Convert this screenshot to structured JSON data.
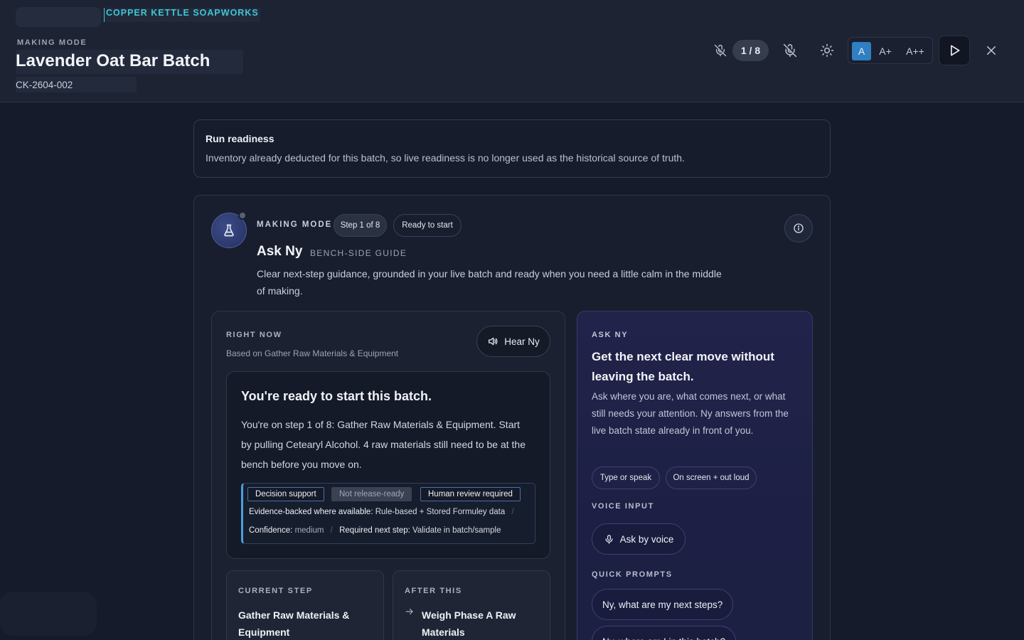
{
  "header": {
    "brand": "COPPER KETTLE SOAPWORKS",
    "mode_kicker": "MAKING MODE",
    "title": "Lavender Oat Bar Batch",
    "batch_code": "CK-2604-002",
    "step_counter": "1 / 8",
    "text_sizes": [
      "A",
      "A+",
      "A++"
    ],
    "icons": [
      "mute-icon",
      "mic-off-icon",
      "sun-icon",
      "play-icon",
      "close-icon"
    ]
  },
  "readiness": {
    "title": "Run readiness",
    "text": "Inventory already deducted for this batch, so live readiness is no longer used as the historical source of truth."
  },
  "guide": {
    "kicker": "MAKING MODE",
    "step_chip": "Step 1 of 8",
    "ready_chip": "Ready to start",
    "title": "Ask Ny",
    "subtitle": "BENCH-SIDE GUIDE",
    "description": "Clear next-step guidance, grounded in your live batch and ready when you need a little calm in the middle of making."
  },
  "right_now": {
    "kicker": "RIGHT NOW",
    "basis": "Based on Gather Raw Materials & Equipment",
    "hear_label": "Hear Ny",
    "ready_title": "You're ready to start this batch.",
    "ready_body": "You're on step 1 of 8: Gather Raw Materials & Equipment. Start by pulling Cetearyl Alcohol. 4 raw materials still need to be at the bench before you move on.",
    "tags": [
      "Decision support",
      "Not release-ready",
      "Human review required"
    ],
    "evidence_label": "Evidence-backed where available:",
    "evidence_value": "Rule-based + Stored Formuley data",
    "confidence_label": "Confidence:",
    "confidence_value": "medium",
    "next_step_label": "Required next step:",
    "next_step_value": "Validate in batch/sample",
    "current_step_kicker": "CURRENT STEP",
    "current_step": "Gather Raw Materials & Equipment",
    "after_kicker": "AFTER THIS",
    "after_step": "Weigh Phase A Raw Materials"
  },
  "ask_panel": {
    "kicker": "ASK NY",
    "title": "Get the next clear move without leaving the batch.",
    "description": "Ask where you are, what comes next, or what still needs your attention. Ny answers from the live batch state already in front of you.",
    "chips": [
      "Type or speak",
      "On screen + out loud"
    ],
    "voice_section": "VOICE INPUT",
    "voice_button": "Ask by voice",
    "prompts_section": "QUICK PROMPTS",
    "prompts": [
      "Ny, what are my next steps?",
      "Ny, where am I in this batch?"
    ]
  },
  "colors": {
    "accent": "#3fc6d8",
    "active_text_size": "#2f7fc1",
    "background": "#151b2a"
  }
}
